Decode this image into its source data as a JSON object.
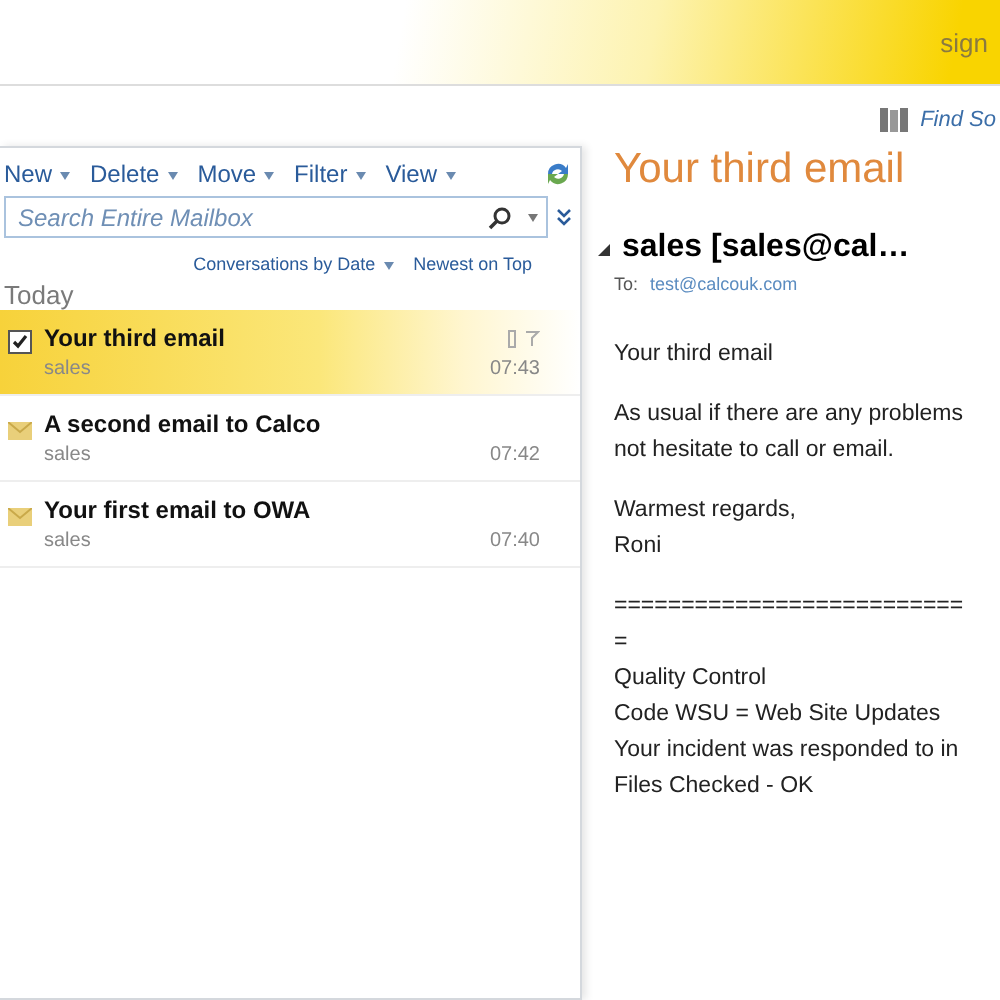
{
  "header": {
    "sign_in": "sign"
  },
  "find_someone": "Find So",
  "toolbar": {
    "menus": [
      "New",
      "Delete",
      "Move",
      "Filter",
      "View"
    ]
  },
  "search": {
    "placeholder": "Search Entire Mailbox"
  },
  "sort": {
    "arrange": "Conversations by Date",
    "order": "Newest on Top"
  },
  "group": "Today",
  "messages": [
    {
      "subject": "Your third email",
      "sender": "sales",
      "time": "07:43",
      "selected": true
    },
    {
      "subject": "A second email to Calco",
      "sender": "sales",
      "time": "07:42",
      "selected": false
    },
    {
      "subject": "Your first email to OWA",
      "sender": "sales",
      "time": "07:40",
      "selected": false
    }
  ],
  "reading": {
    "subject": "Your third email",
    "from": "sales [sales@cal…",
    "to_label": "To:",
    "to": "test@calcouk.com",
    "body": [
      [
        "Your third email"
      ],
      [
        "As usual if there are any problems",
        "not hesitate to call or email."
      ],
      [
        "Warmest regards,",
        "Roni"
      ],
      [
        "==========================",
        "=",
        "Quality Control",
        "Code WSU = Web Site Updates",
        "Your incident was responded to in",
        "Files Checked - OK"
      ]
    ]
  }
}
